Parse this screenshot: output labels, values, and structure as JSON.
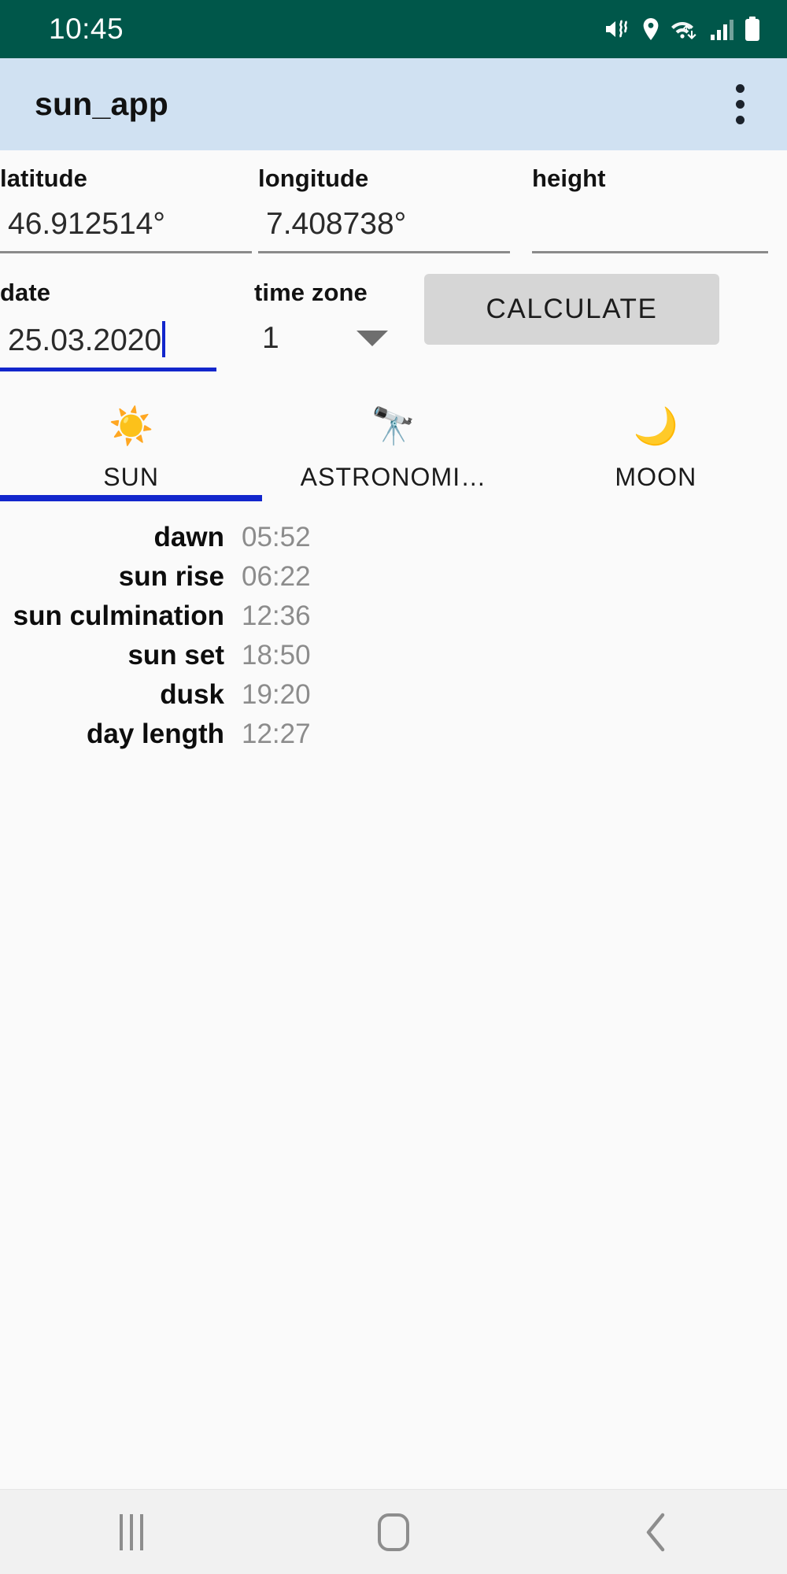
{
  "status_bar": {
    "clock": "10:45",
    "icons": [
      "mute-vibrate-icon",
      "location-pin-icon",
      "wifi-icon",
      "signal-bars-icon",
      "battery-icon"
    ],
    "background": "#00574a",
    "foreground": "#ffffff"
  },
  "app_bar": {
    "title": "sun_app",
    "overflow_label": "More options",
    "background": "#d0e1f2"
  },
  "form": {
    "latitude": {
      "label": "latitude",
      "value": "46.912514°"
    },
    "longitude": {
      "label": "longitude",
      "value": "7.408738°"
    },
    "height": {
      "label": "height",
      "value": ""
    },
    "date": {
      "label": "date",
      "value": "25.03.2020",
      "focused": true
    },
    "time_zone": {
      "label": "time zone",
      "value": "1"
    },
    "calculate_button": "CALCULATE"
  },
  "tabs": {
    "selected_index": 0,
    "accent": "#1226cc",
    "items": [
      {
        "label": "SUN",
        "icon": "☀️",
        "icon_name": "sun-emoji-icon"
      },
      {
        "label": "ASTRONOMI…",
        "icon": "🔭",
        "icon_name": "telescope-emoji-icon"
      },
      {
        "label": "MOON",
        "icon": "🌙",
        "icon_name": "crescent-moon-emoji-icon"
      }
    ]
  },
  "results": {
    "rows": [
      {
        "label": "dawn",
        "value": "05:52"
      },
      {
        "label": "sun rise",
        "value": "06:22"
      },
      {
        "label": "sun culmination",
        "value": "12:36"
      },
      {
        "label": "sun set",
        "value": "18:50"
      },
      {
        "label": "dusk",
        "value": "19:20"
      },
      {
        "label": "day length",
        "value": "12:27"
      }
    ]
  },
  "nav_bar": {
    "recents_label": "Recents",
    "home_label": "Home",
    "back_label": "Back"
  }
}
